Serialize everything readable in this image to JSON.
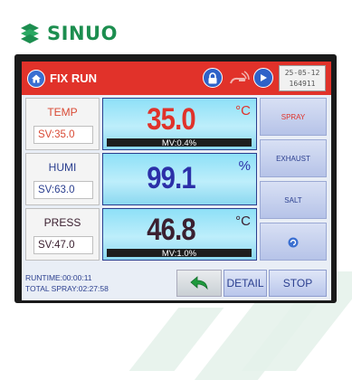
{
  "brand": {
    "name": "SINUO",
    "color": "#1c8e4f"
  },
  "header": {
    "title": "FIX RUN",
    "date": "25-05-12",
    "time": "164911",
    "background": "#e1322a"
  },
  "rows": [
    {
      "name": "TEMP",
      "sv": "SV:35.0",
      "value": "35.0",
      "unit": "°C",
      "mv": "MV:0.4%",
      "value_color": "#e0322a",
      "has_mv": true
    },
    {
      "name": "HUMI",
      "sv": "SV:63.0",
      "value": "99.1",
      "unit": "%",
      "mv": "",
      "value_color": "#2b2fa8",
      "has_mv": false
    },
    {
      "name": "PRESS",
      "sv": "SV:47.0",
      "value": "46.8",
      "unit": "°C",
      "mv": "MV:1.0%",
      "value_color": "#3b2030",
      "has_mv": true
    }
  ],
  "side_buttons": [
    {
      "label": "SPRAY",
      "color": "#e0322a"
    },
    {
      "label": "EXHAUST",
      "color": "#2b3f8f"
    },
    {
      "label": "SALT",
      "color": "#2b3f8f"
    },
    {
      "label": "",
      "icon": "refresh-icon"
    }
  ],
  "footer": {
    "runtime": "RUNTIME:00:00:11",
    "total_spray": "TOTAL SPRAY:02:27:58",
    "detail_label": "DETAIL",
    "stop_label": "STOP"
  }
}
